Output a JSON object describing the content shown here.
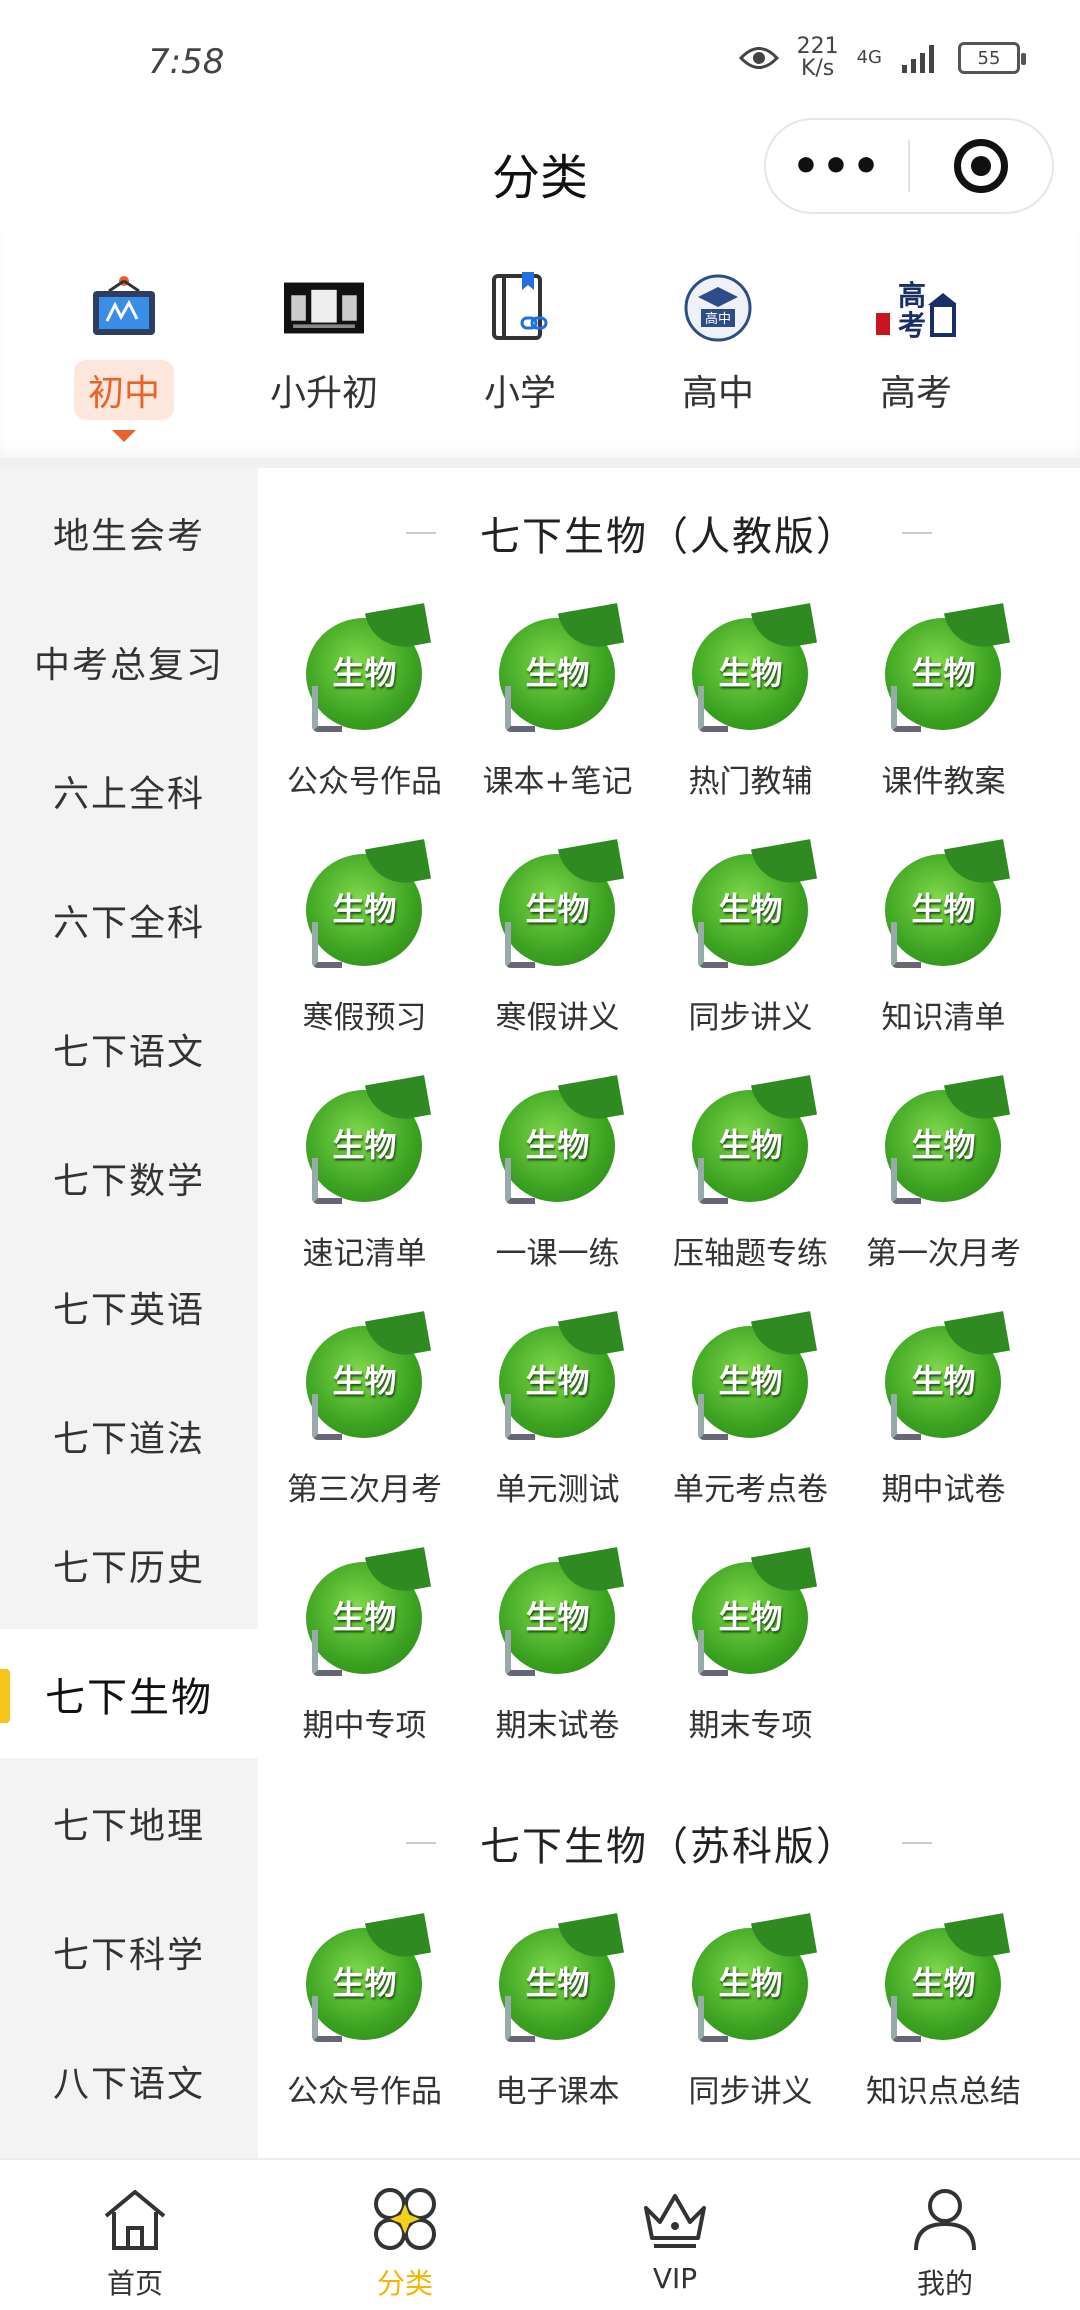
{
  "status_bar": {
    "time": "7:58",
    "net_speed_value": "221",
    "net_speed_unit": "K/s",
    "network": "4G",
    "battery": "55"
  },
  "header": {
    "title": "分类",
    "more_icon": "more-dots-icon",
    "close_icon": "target-circle-icon"
  },
  "level_tabs": [
    {
      "label": "初中",
      "icon": "blackboard-icon",
      "active": true
    },
    {
      "label": "小升初",
      "icon": "poster-thumbnail-icon",
      "active": false
    },
    {
      "label": "小学",
      "icon": "book-link-icon",
      "active": false
    },
    {
      "label": "高中",
      "icon": "graduation-cap-badge-icon",
      "active": false
    },
    {
      "label": "高考",
      "icon": "gaokao-building-icon",
      "active": false
    }
  ],
  "sidebar": {
    "items": [
      {
        "label": "地生会考"
      },
      {
        "label": "中考总复习"
      },
      {
        "label": "六上全科"
      },
      {
        "label": "六下全科"
      },
      {
        "label": "七下语文"
      },
      {
        "label": "七下数学"
      },
      {
        "label": "七下英语"
      },
      {
        "label": "七下道法"
      },
      {
        "label": "七下历史"
      },
      {
        "label": "七下生物"
      },
      {
        "label": "七下地理"
      },
      {
        "label": "七下科学"
      },
      {
        "label": "八下语文"
      }
    ],
    "active_index": 9,
    "accent_color": "#f5c518"
  },
  "sections": [
    {
      "title": "七下生物（人教版）",
      "thumb_text": "生物",
      "items": [
        {
          "label": "公众号作品"
        },
        {
          "label": "课本+笔记"
        },
        {
          "label": "热门教辅"
        },
        {
          "label": "课件教案"
        },
        {
          "label": "寒假预习"
        },
        {
          "label": "寒假讲义"
        },
        {
          "label": "同步讲义"
        },
        {
          "label": "知识清单"
        },
        {
          "label": "速记清单"
        },
        {
          "label": "一课一练"
        },
        {
          "label": "压轴题专练"
        },
        {
          "label": "第一次月考"
        },
        {
          "label": "第三次月考"
        },
        {
          "label": "单元测试"
        },
        {
          "label": "单元考点卷"
        },
        {
          "label": "期中试卷"
        },
        {
          "label": "期中专项"
        },
        {
          "label": "期末试卷"
        },
        {
          "label": "期末专项"
        }
      ]
    },
    {
      "title": "七下生物（苏科版）",
      "thumb_text": "生物",
      "items": [
        {
          "label": "公众号作品"
        },
        {
          "label": "电子课本"
        },
        {
          "label": "同步讲义"
        },
        {
          "label": "知识点总结"
        }
      ]
    }
  ],
  "tab_bar": {
    "tabs": [
      {
        "label": "首页",
        "icon": "home-icon"
      },
      {
        "label": "分类",
        "icon": "category-grid-icon"
      },
      {
        "label": "VIP",
        "icon": "crown-icon"
      },
      {
        "label": "我的",
        "icon": "user-icon"
      }
    ],
    "active_index": 1,
    "active_color": "#f2b705"
  }
}
